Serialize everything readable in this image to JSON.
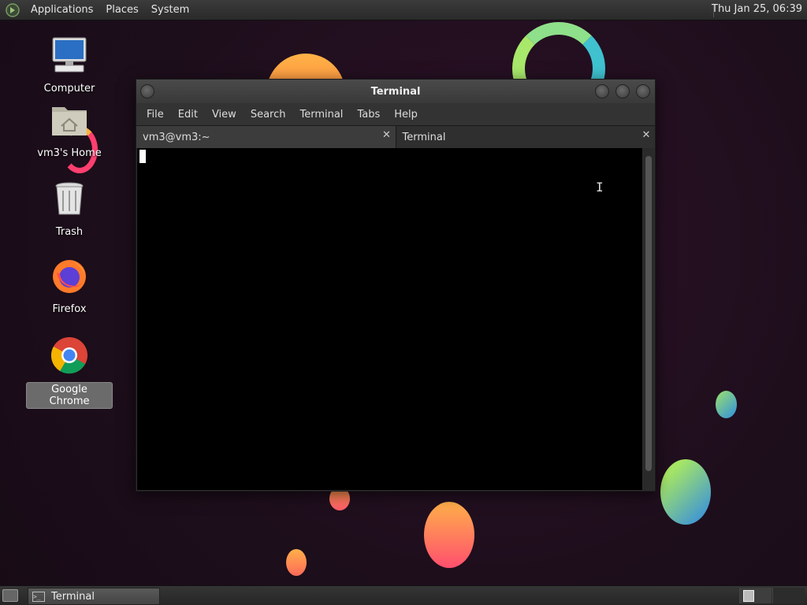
{
  "top_panel": {
    "menus": [
      "Applications",
      "Places",
      "System"
    ],
    "clock": "Thu Jan 25, 06:39"
  },
  "desktop_icons": [
    {
      "label": "Computer",
      "icon": "computer-icon"
    },
    {
      "label": "vm3's Home",
      "icon": "home-folder-icon"
    },
    {
      "label": "Trash",
      "icon": "trash-icon"
    },
    {
      "label": "Firefox",
      "icon": "firefox-icon"
    },
    {
      "label": "Google Chrome",
      "icon": "chrome-icon",
      "selected": true
    }
  ],
  "window": {
    "title": "Terminal",
    "menus": [
      "File",
      "Edit",
      "View",
      "Search",
      "Terminal",
      "Tabs",
      "Help"
    ],
    "tabs": [
      {
        "label": "vm3@vm3:~",
        "active": false
      },
      {
        "label": "Terminal",
        "active": true
      }
    ],
    "close_glyph": "✕"
  },
  "taskbar": {
    "items": [
      {
        "label": "Terminal",
        "icon": "terminal-icon"
      }
    ]
  },
  "colors": {
    "desktop_bg": "#22101f",
    "terminal_bg": "#000000"
  }
}
